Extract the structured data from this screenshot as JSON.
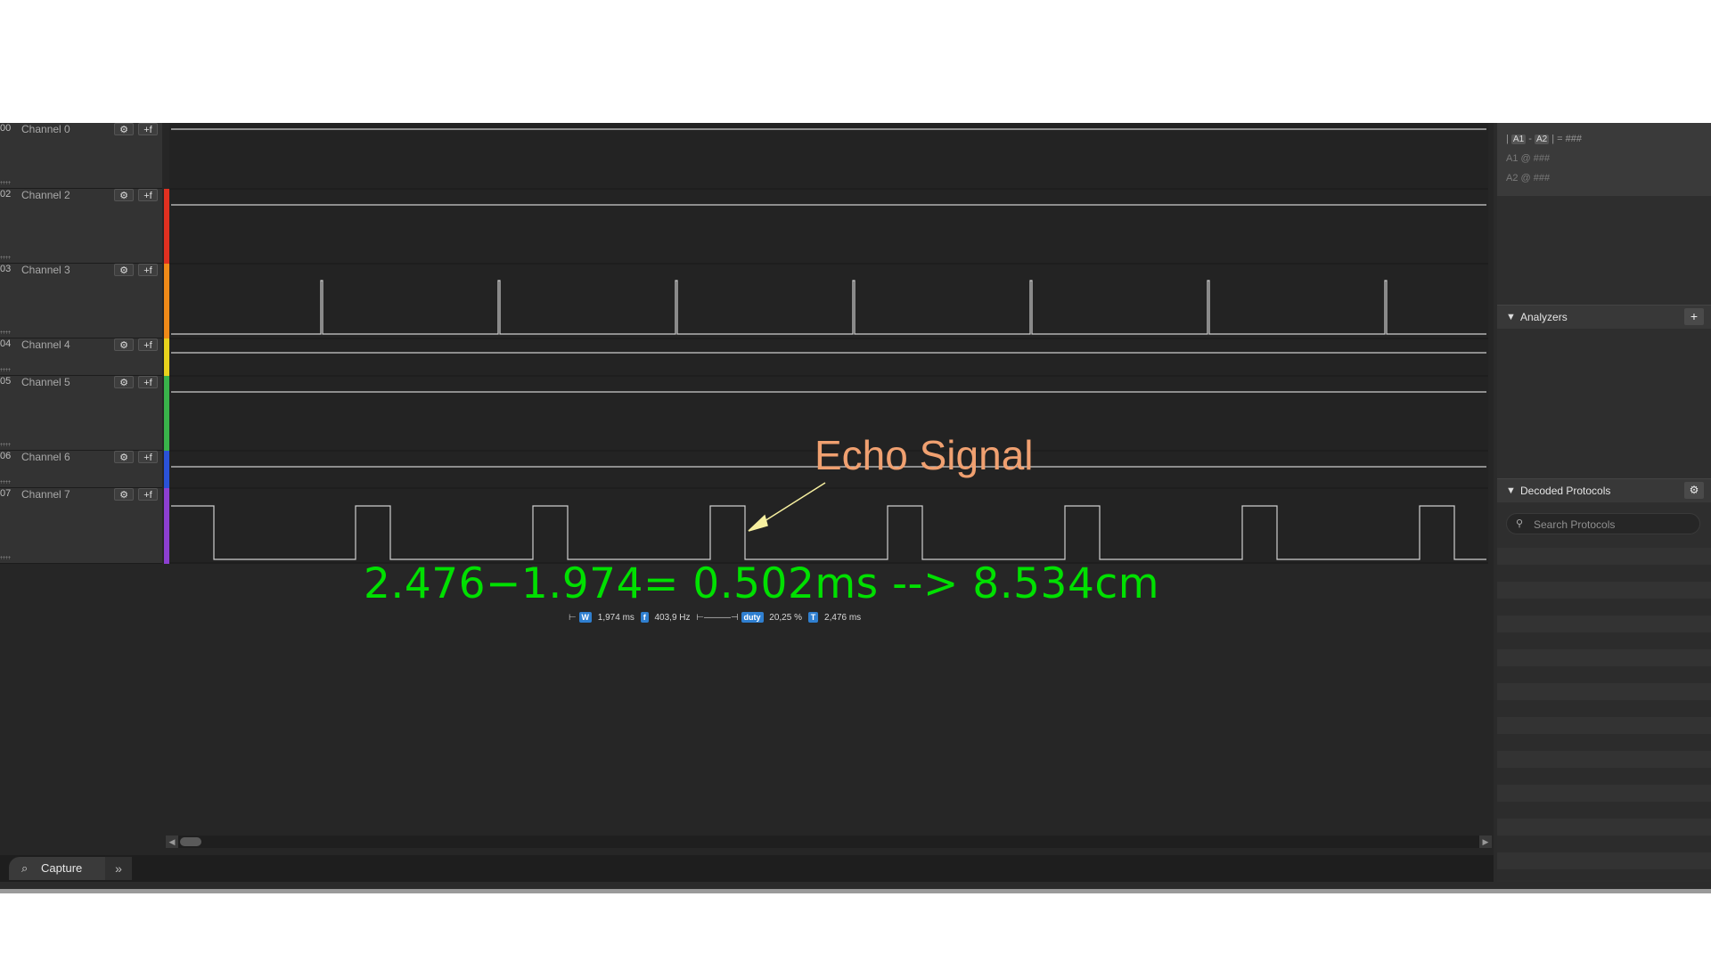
{
  "channels": [
    {
      "num": "00",
      "name": "Channel 0",
      "color": "#262626"
    },
    {
      "num": "02",
      "name": "Channel 2",
      "color": "#e03020"
    },
    {
      "num": "03",
      "name": "Channel 3",
      "color": "#f08a18"
    },
    {
      "num": "04",
      "name": "Channel 4",
      "color": "#e8d21c"
    },
    {
      "num": "05",
      "name": "Channel 5",
      "color": "#39b34a"
    },
    {
      "num": "06",
      "name": "Channel 6",
      "color": "#2a52d8"
    },
    {
      "num": "07",
      "name": "Channel 7",
      "color": "#8c3fd0"
    }
  ],
  "icons": {
    "gear": "gear-icon",
    "trigger": "trigger-icon",
    "search": "search-icon",
    "capture": "capture-icon"
  },
  "measurement": {
    "width_tag": "W",
    "width_value": "1,974 ms",
    "freq_tag": "f",
    "freq_value": "403,9 Hz",
    "duty_tag": "duty",
    "duty_value": "20,25 %",
    "period_tag": "T",
    "period_value": "2,476 ms"
  },
  "annotation": {
    "label": "Echo Signal",
    "formula": "2.476−1.974= 0.502ms --> 8.534cm",
    "label_color": "#f0a070",
    "formula_color": "#00e000"
  },
  "cursor_panel": {
    "line1_a1": "A1",
    "line1_sep": "-",
    "line1_a2": "A2",
    "line1_eq": "= ###",
    "line2": "A1  @  ###",
    "line3": "A2  @  ###"
  },
  "analyzers": {
    "title": "Analyzers",
    "add_label": "+"
  },
  "decoded": {
    "title": "Decoded Protocols",
    "search_placeholder": "Search Protocols"
  },
  "bottom": {
    "capture_label": "Capture",
    "more_label": "»"
  }
}
